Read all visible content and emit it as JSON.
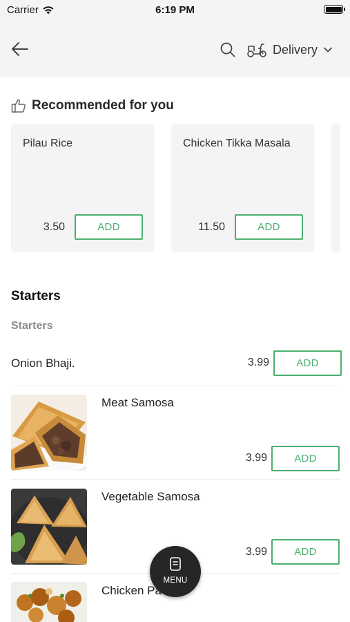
{
  "status_bar": {
    "carrier": "Carrier",
    "time": "6:19 PM"
  },
  "header": {
    "delivery_label": "Delivery",
    "icons": [
      "back-arrow-icon",
      "search-icon",
      "scooter-icon",
      "chevron-down-icon"
    ]
  },
  "recommended": {
    "title": "Recommended for you",
    "items": [
      {
        "name": "Pilau Rice",
        "price": "3.50",
        "add_label": "ADD"
      },
      {
        "name": "Chicken Tikka Masala",
        "price": "11.50",
        "add_label": "ADD"
      }
    ]
  },
  "menu": {
    "section_title": "Starters",
    "category_title": "Starters",
    "items": [
      {
        "name": "Onion Bhaji.",
        "price": "3.99",
        "add_label": "ADD"
      },
      {
        "name": "Meat Samosa",
        "price": "3.99",
        "add_label": "ADD"
      },
      {
        "name": "Vegetable Samosa",
        "price": "3.99",
        "add_label": "ADD"
      },
      {
        "name": "Chicken Pa",
        "price": "",
        "add_label": ""
      }
    ]
  },
  "fab": {
    "label": "MENU"
  },
  "colors": {
    "accent_green": "#4caf6e",
    "header_bg": "#f4f4f4",
    "fab_bg": "#262626"
  }
}
